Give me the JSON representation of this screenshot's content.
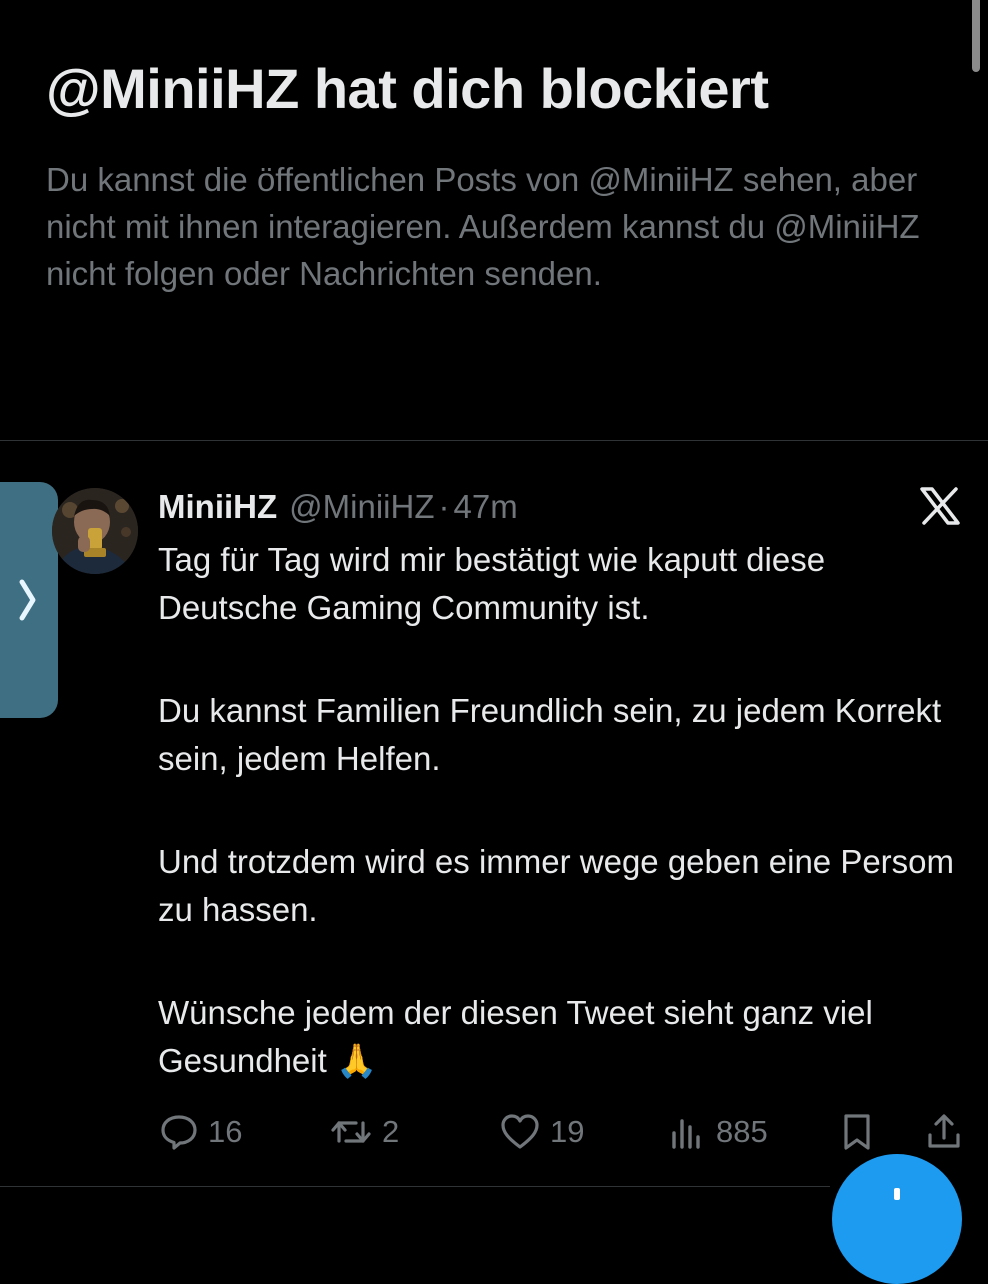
{
  "blocked_screen": {
    "title": "@MiniiHZ hat dich blockiert",
    "description": "Du kannst die öffentlichen Posts von @MiniiHZ sehen, aber nicht mit ihnen interagieren. Außerdem kannst du @MiniiHZ nicht folgen oder Nachrichten senden."
  },
  "tweet": {
    "display_name": "MiniiHZ",
    "handle": "@MiniiHZ",
    "separator": "·",
    "time": "47m",
    "paragraphs": [
      "Tag für Tag wird mir bestätigt wie kaputt diese Deutsche Gaming Community ist.",
      "Du kannst Familien Freundlich sein, zu jedem Korrekt sein, jedem Helfen.",
      "Und trotzdem wird es immer wege geben eine Persom zu hassen.",
      "Wünsche jedem der diesen Tweet sieht ganz viel Gesundheit 🙏"
    ],
    "stats": {
      "replies": "16",
      "reposts": "2",
      "likes": "19",
      "views": "885"
    }
  },
  "icons": {
    "side_tab": "chevron-right-icon",
    "source": "x-logo-icon",
    "reply": "reply-icon",
    "repost": "repost-icon",
    "like": "heart-icon",
    "views": "views-icon",
    "bookmark": "bookmark-icon",
    "share": "share-icon"
  },
  "colors": {
    "background": "#000000",
    "primary_text": "#e7e9ea",
    "secondary_text": "#71767b",
    "divider": "#2f3336",
    "side_tab": "#3f6f82",
    "fab": "#1d9bf0"
  }
}
